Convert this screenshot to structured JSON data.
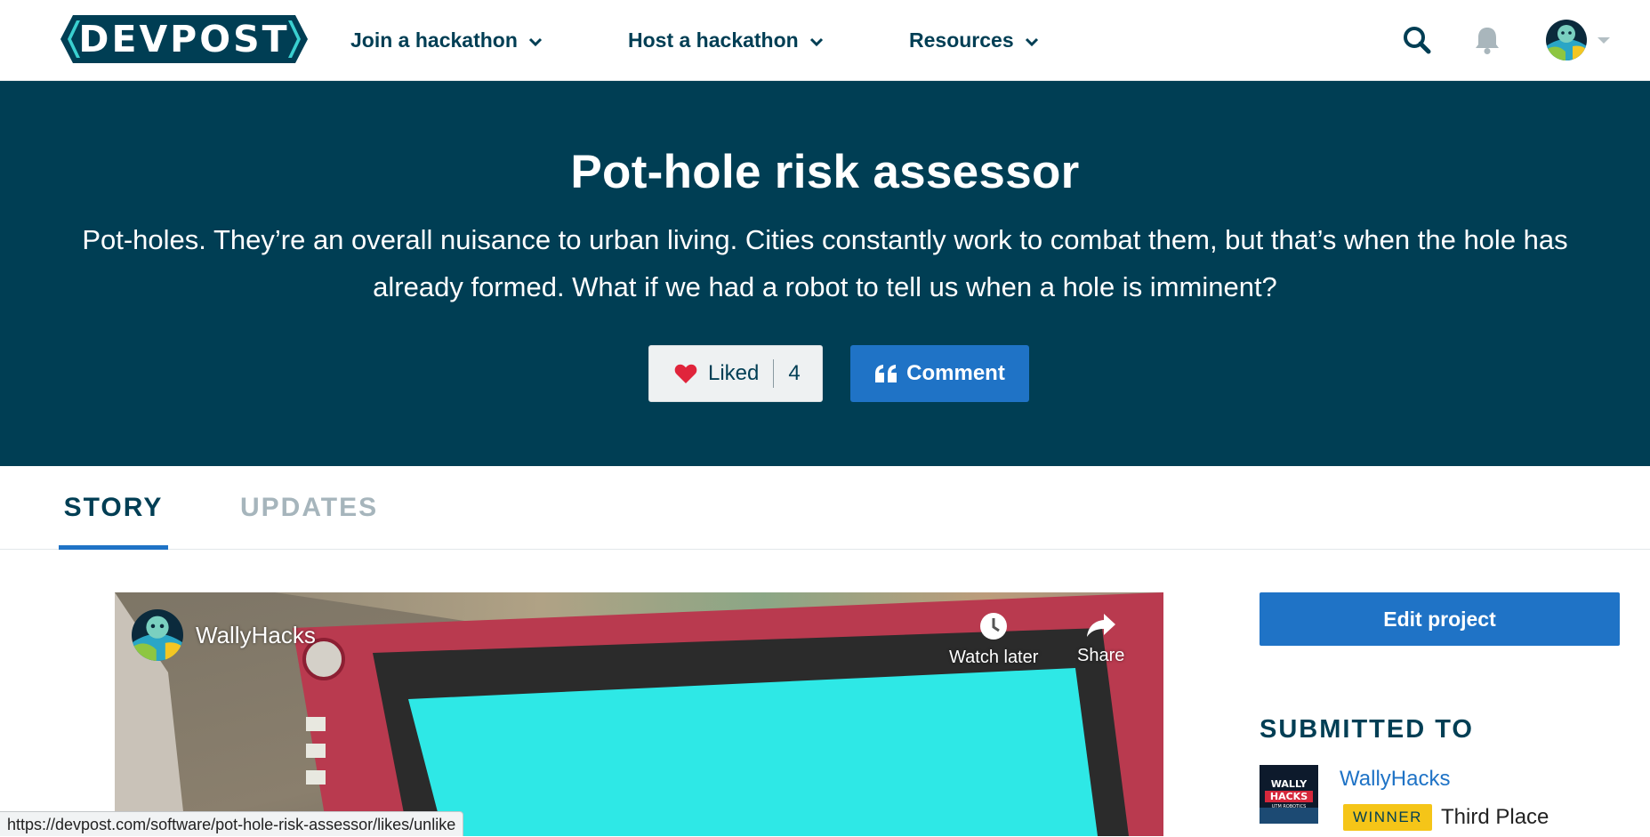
{
  "nav": {
    "logo_text": "DEVPOST",
    "links": [
      {
        "label": "Join a hackathon"
      },
      {
        "label": "Host a hackathon"
      },
      {
        "label": "Resources"
      }
    ],
    "icons": [
      "search-icon",
      "bell-icon",
      "avatar",
      "caret-down-icon"
    ]
  },
  "hero": {
    "title": "Pot-hole risk assessor",
    "tagline": "Pot-holes. They’re an overall nuisance to urban living. Cities constantly work to combat them, but that’s when the hole has already formed. What if we had a robot to tell us when a hole is imminent?",
    "like_label": "Liked",
    "like_count": "4",
    "comment_label": "Comment"
  },
  "tabs": [
    {
      "label": "STORY",
      "active": true
    },
    {
      "label": "UPDATES",
      "active": false
    }
  ],
  "video": {
    "channel": "WallyHacks",
    "watch_later": "Watch later",
    "share": "Share"
  },
  "sidebar": {
    "edit_label": "Edit project",
    "submitted_heading": "SUBMITTED TO",
    "submission": {
      "name": "WallyHacks",
      "badge": "WINNER",
      "prize": "Third Place",
      "thumb_text": [
        "WALLY",
        "HACKS",
        "UTM ROBOTICS"
      ]
    }
  },
  "statusbar": {
    "url": "https://devpost.com/software/pot-hole-risk-assessor/likes/unlike"
  },
  "colors": {
    "navy": "#003e54",
    "accent_blue": "#1f73c6",
    "winner_yellow": "#f5c518",
    "heart_red": "#e0243b"
  }
}
